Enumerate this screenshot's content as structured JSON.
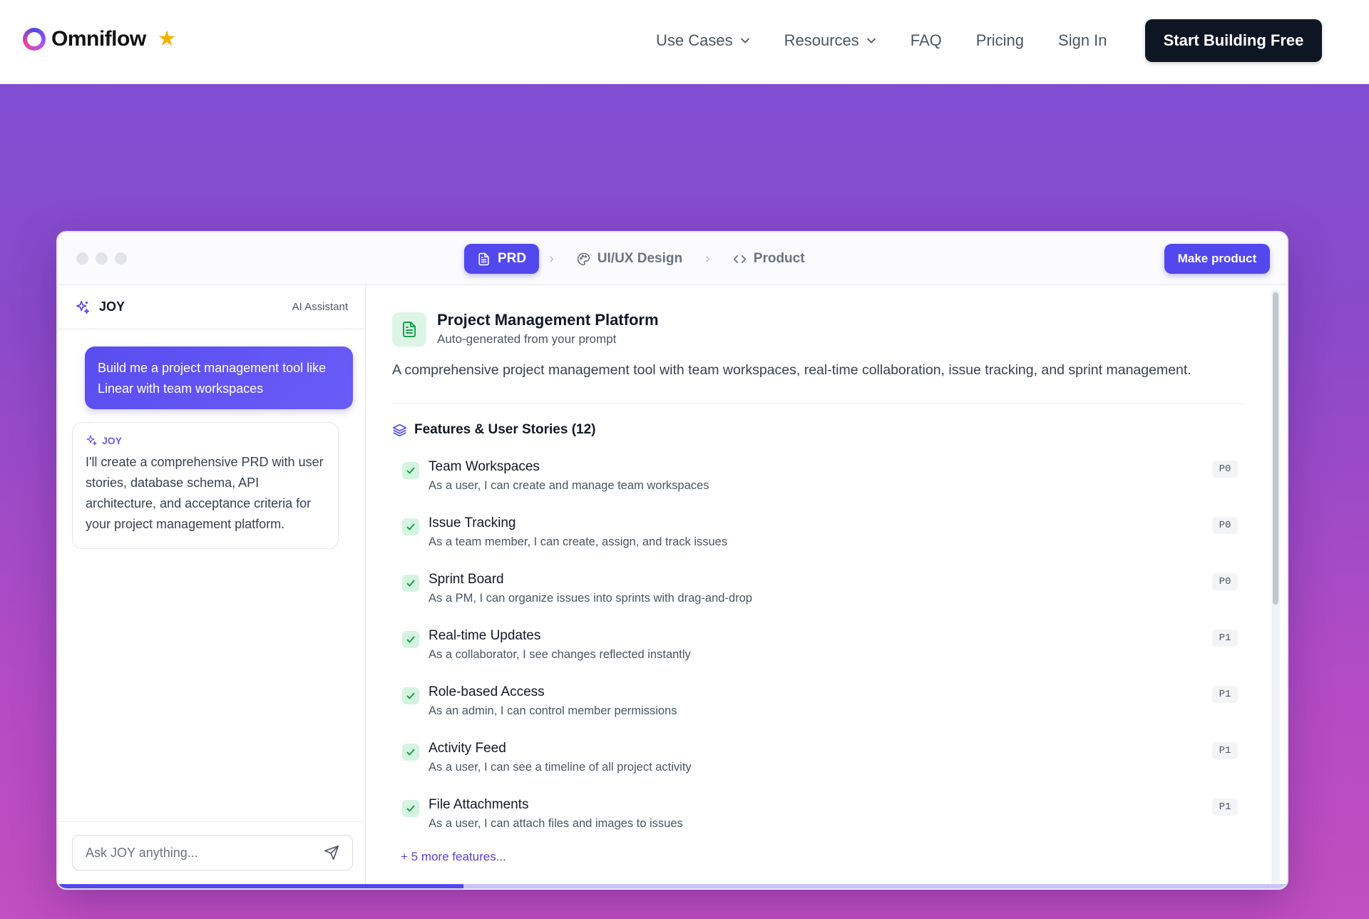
{
  "nav": {
    "brand": "Omniflow",
    "links": [
      {
        "label": "Use Cases",
        "dropdown": true
      },
      {
        "label": "Resources",
        "dropdown": true
      },
      {
        "label": "FAQ",
        "dropdown": false
      },
      {
        "label": "Pricing",
        "dropdown": false
      },
      {
        "label": "Sign In",
        "dropdown": false
      }
    ],
    "cta": "Start Building Free"
  },
  "window": {
    "steps": [
      {
        "label": "PRD",
        "icon": "file-text-icon",
        "active": true
      },
      {
        "label": "UI/UX Design",
        "icon": "palette-icon",
        "active": false
      },
      {
        "label": "Product",
        "icon": "code-icon",
        "active": false
      }
    ],
    "make_button": "Make product",
    "progress_fraction": 0.33
  },
  "chat": {
    "title": "JOY",
    "subtitle": "AI Assistant",
    "user_message": "Build me a project management tool like Linear with team workspaces",
    "ai_label": "JOY",
    "ai_message": "I'll create a comprehensive PRD with user stories, database schema, API architecture, and acceptance criteria for your project management platform.",
    "input_placeholder": "Ask JOY anything..."
  },
  "prd": {
    "title": "Project Management Platform",
    "subtitle": "Auto-generated from your prompt",
    "description": "A comprehensive project management tool with team workspaces, real-time collaboration, issue tracking, and sprint management.",
    "features_heading": "Features & User Stories (12)",
    "features": [
      {
        "name": "Team Workspaces",
        "story": "As a user, I can create and manage team workspaces",
        "priority": "P0"
      },
      {
        "name": "Issue Tracking",
        "story": "As a team member, I can create, assign, and track issues",
        "priority": "P0"
      },
      {
        "name": "Sprint Board",
        "story": "As a PM, I can organize issues into sprints with drag-and-drop",
        "priority": "P0"
      },
      {
        "name": "Real-time Updates",
        "story": "As a collaborator, I see changes reflected instantly",
        "priority": "P1"
      },
      {
        "name": "Role-based Access",
        "story": "As an admin, I can control member permissions",
        "priority": "P1"
      },
      {
        "name": "Activity Feed",
        "story": "As a user, I can see a timeline of all project activity",
        "priority": "P1"
      },
      {
        "name": "File Attachments",
        "story": "As a user, I can attach files and images to issues",
        "priority": "P1"
      }
    ],
    "more_link": "+ 5 more features..."
  },
  "colors": {
    "accent": "#5248ee",
    "dark_button": "#0f1623",
    "success": "#16a34a",
    "star": "#f5b301"
  }
}
